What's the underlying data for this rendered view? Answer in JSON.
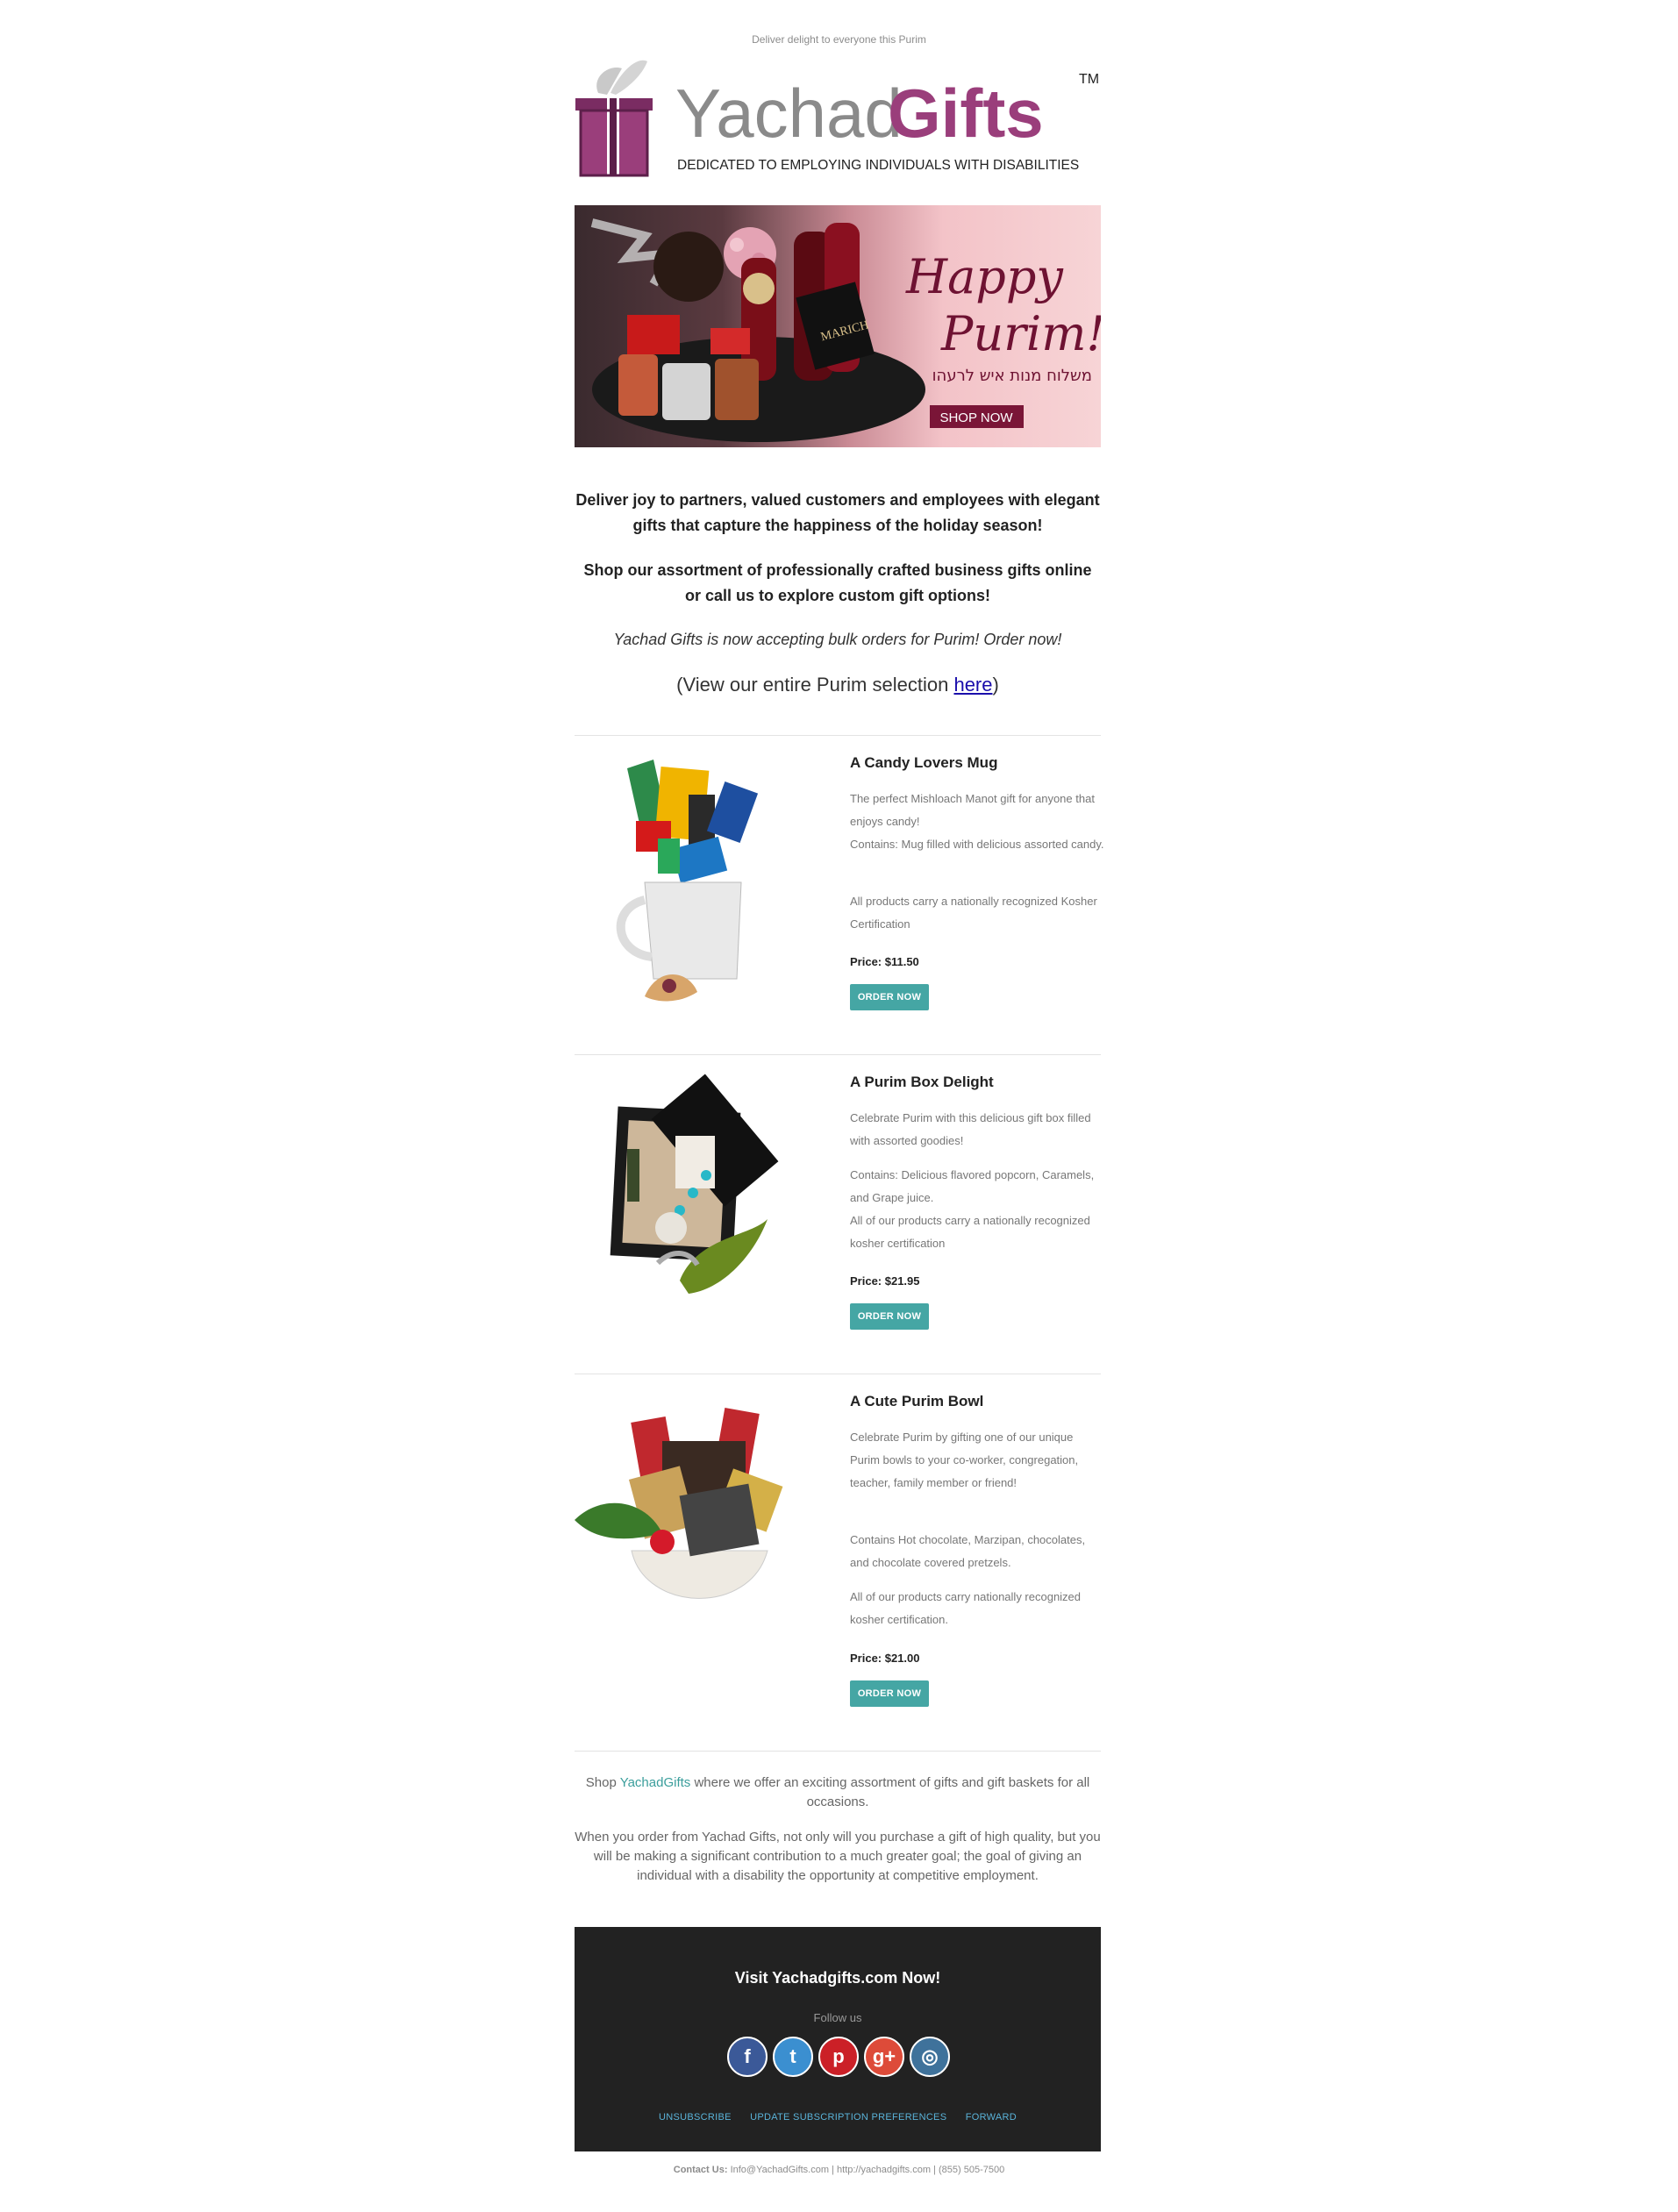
{
  "preheader": "Deliver delight to everyone this Purim",
  "logo": {
    "word1": "Yachad",
    "word2": "Gifts",
    "tagline": "DEDICATED TO EMPLOYING INDIVIDUALS WITH DISABILITIES",
    "tm": "TM"
  },
  "hero": {
    "title1": "Happy",
    "title2": "Purim!",
    "hebrew": "משלוח מנות איש לרעהו",
    "cta": "SHOP NOW",
    "bottle_label": "MARICH"
  },
  "intro": {
    "p1": "Deliver joy to partners, valued customers and employees with elegant gifts that capture the happiness of the holiday season!",
    "p2": "Shop our assortment of professionally crafted business gifts online or call us to explore custom gift options!",
    "p3": "Yachad Gifts is now accepting bulk orders for Purim! Order now!",
    "p4_prefix": "(View our entire Purim selection ",
    "p4_link": "here",
    "p4_suffix": ")"
  },
  "products": [
    {
      "title": "A Candy Lovers Mug",
      "desc": [
        "The perfect Mishloach Manot gift for anyone that enjoys candy!",
        "Contains: Mug filled with delicious assorted candy.",
        "All products carry a nationally recognized Kosher Certification"
      ],
      "price": "Price: $11.50",
      "button": "ORDER NOW"
    },
    {
      "title": "A Purim Box Delight",
      "desc": [
        "Celebrate Purim with this delicious gift box filled with assorted goodies!",
        "Contains: Delicious flavored popcorn, Caramels, and Grape juice.",
        "All of our products carry a nationally recognized kosher certification"
      ],
      "price": "Price: $21.95",
      "button": "ORDER NOW"
    },
    {
      "title": "A Cute Purim Bowl",
      "desc": [
        "Celebrate Purim by gifting one of our unique Purim bowls to your co-worker, congregation, teacher, family member or friend!",
        "Contains Hot chocolate, Marzipan, chocolates, and chocolate covered pretzels.",
        "All of our products carry nationally recognized kosher certification."
      ],
      "price": "Price: $21.00",
      "button": "ORDER NOW"
    }
  ],
  "shop": {
    "prefix": "Shop ",
    "link": "YachadGifts",
    "suffix": " where we offer an exciting assortment of gifts and gift baskets for all occasions.",
    "p2": "When you order from Yachad Gifts, not only will you purchase a gift of high quality, but you will be making a significant contribution to a much greater goal; the goal of giving an individual with a disability the opportunity at competitive employment."
  },
  "footer": {
    "visit": "Visit Yachadgifts.com Now!",
    "follow": "Follow us",
    "socials": [
      {
        "name": "facebook-icon",
        "glyph": "f",
        "color": "#3b5998"
      },
      {
        "name": "twitter-icon",
        "glyph": "t",
        "color": "#3b8fd0"
      },
      {
        "name": "pinterest-icon",
        "glyph": "p",
        "color": "#cb2027"
      },
      {
        "name": "google-plus-icon",
        "glyph": "g+",
        "color": "#dd4b39"
      },
      {
        "name": "instagram-icon",
        "glyph": "◎",
        "color": "#3f729b"
      }
    ],
    "links": [
      "UNSUBSCRIBE",
      "UPDATE SUBSCRIPTION PREFERENCES",
      "FORWARD"
    ]
  },
  "contact": {
    "label": "Contact Us:",
    "email": "Info@YachadGifts.com",
    "sep1": " | ",
    "site": "http://yachadgifts.com",
    "sep2": " | ",
    "phone": "(855) 505-7500"
  },
  "colors": {
    "brand_purple": "#9a3e7b",
    "brand_gray": "#8a8a8a",
    "button_teal": "#45a6a4",
    "footer_bg": "#222222"
  }
}
